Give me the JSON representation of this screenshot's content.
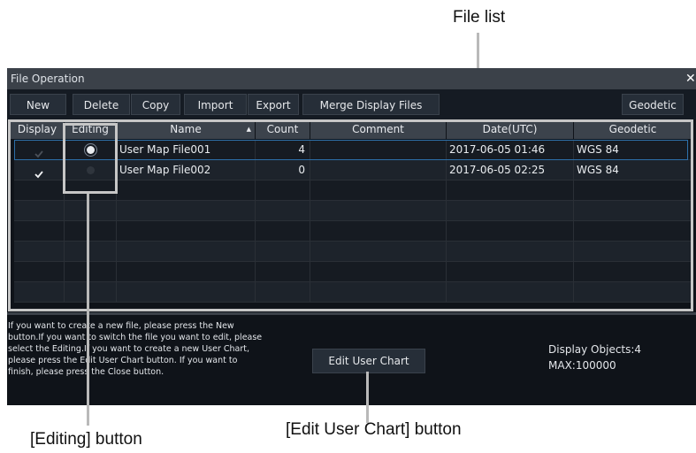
{
  "annotations": {
    "file_list": "File list",
    "editing_button": "[Editing] button",
    "edit_user_chart_button": "[Edit User Chart] button"
  },
  "window": {
    "title": "File Operation",
    "close_glyph": "✕"
  },
  "toolbar": {
    "new": "New",
    "delete": "Delete",
    "copy": "Copy",
    "import": "Import",
    "export": "Export",
    "merge": "Merge Display Files",
    "geodetic": "Geodetic"
  },
  "table": {
    "headers": {
      "display": "Display",
      "editing": "Editing",
      "name": "Name",
      "sort_glyph": "▲",
      "count": "Count",
      "comment": "Comment",
      "date": "Date(UTC)",
      "geodetic": "Geodetic"
    },
    "rows": [
      {
        "display_checked": true,
        "display_enabled": false,
        "editing_selected": true,
        "name": "User Map File001",
        "count": "4",
        "comment": "",
        "date": "2017-06-05 01:46",
        "geodetic": "WGS 84"
      },
      {
        "display_checked": true,
        "display_enabled": true,
        "editing_selected": false,
        "name": "User Map File002",
        "count": "0",
        "comment": "",
        "date": "2017-06-05 02:25",
        "geodetic": "WGS 84"
      }
    ]
  },
  "footer": {
    "info_lines": [
      "If you want to create a new file, please press the New",
      "button.If you want to switch the file you want to edit, please",
      "select the Editing.If you want to create a new User Chart,",
      "please press the Edit User Chart button. If you want to",
      "finish, please press the Close button."
    ],
    "edit_user_chart": "Edit User Chart",
    "display_objects": "Display Objects:4",
    "max": "MAX:100000"
  },
  "colors": {
    "selection_border": "#2d6fa8",
    "radio_selected": "#e9ecef",
    "radio_unselected": "#2f353d"
  }
}
